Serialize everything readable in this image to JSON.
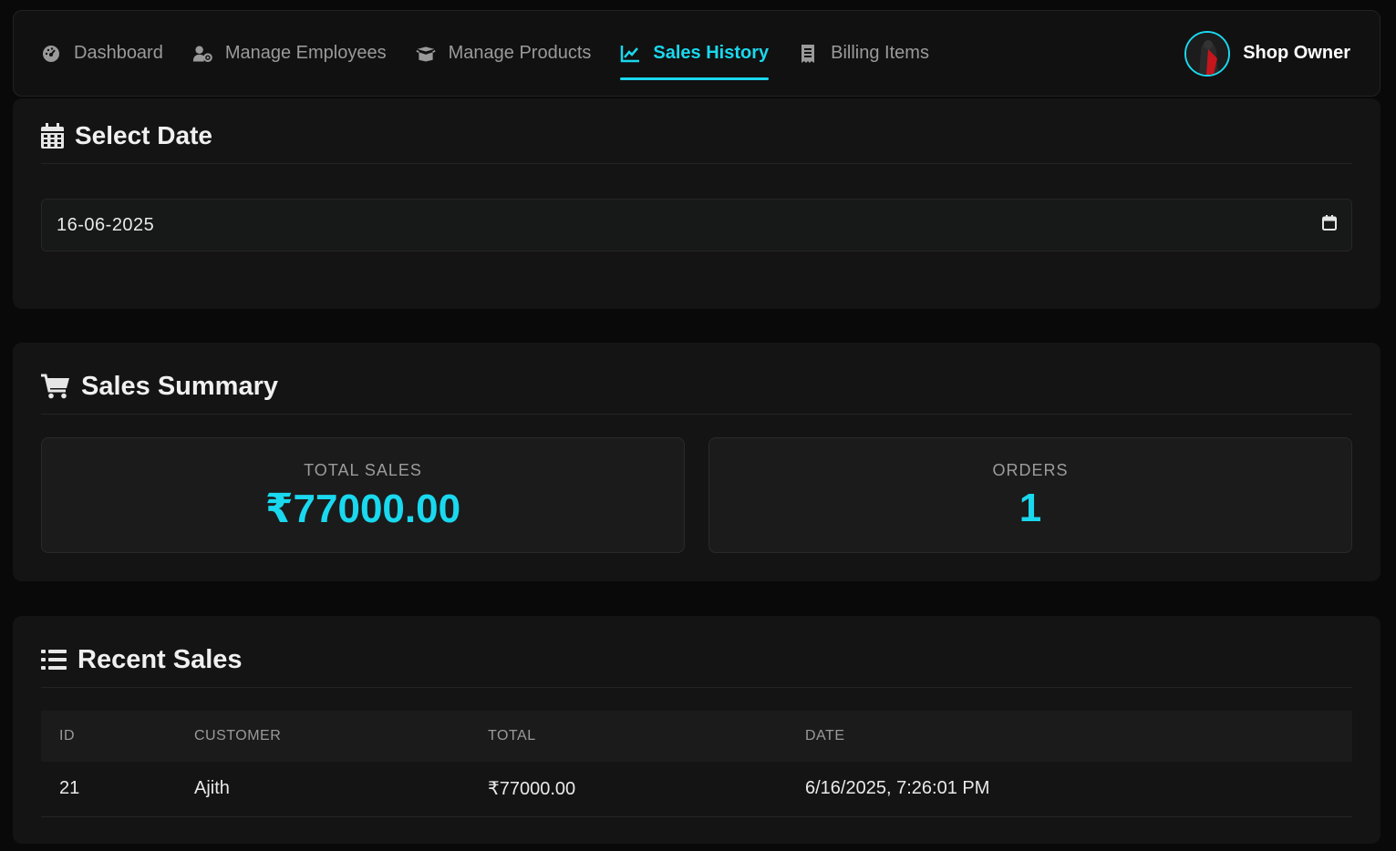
{
  "nav": {
    "items": [
      {
        "label": "Dashboard",
        "icon": "dashboard-icon",
        "active": false
      },
      {
        "label": "Manage Employees",
        "icon": "users-cog-icon",
        "active": false
      },
      {
        "label": "Manage Products",
        "icon": "box-open-icon",
        "active": false
      },
      {
        "label": "Sales History",
        "icon": "chart-line-icon",
        "active": true
      },
      {
        "label": "Billing Items",
        "icon": "receipt-icon",
        "active": false
      }
    ],
    "profile": {
      "name": "Shop Owner",
      "avatar": "avatar-image"
    }
  },
  "select_date": {
    "title": "Select Date",
    "icon": "calendar-icon",
    "value": "16-06-2025",
    "picker_icon": "calendar-small-icon"
  },
  "summary": {
    "title": "Sales Summary",
    "icon": "cart-icon",
    "total_sales_label": "TOTAL SALES",
    "total_sales_value": "₹77000.00",
    "orders_label": "ORDERS",
    "orders_value": "1"
  },
  "recent": {
    "title": "Recent Sales",
    "icon": "list-icon",
    "columns": [
      "ID",
      "CUSTOMER",
      "TOTAL",
      "DATE"
    ],
    "rows": [
      [
        "21",
        "Ajith",
        "₹77000.00",
        "6/16/2025, 7:26:01 PM"
      ]
    ]
  },
  "colors": {
    "accent": "#1ad8ee",
    "background": "#090909",
    "card": "#141414"
  }
}
